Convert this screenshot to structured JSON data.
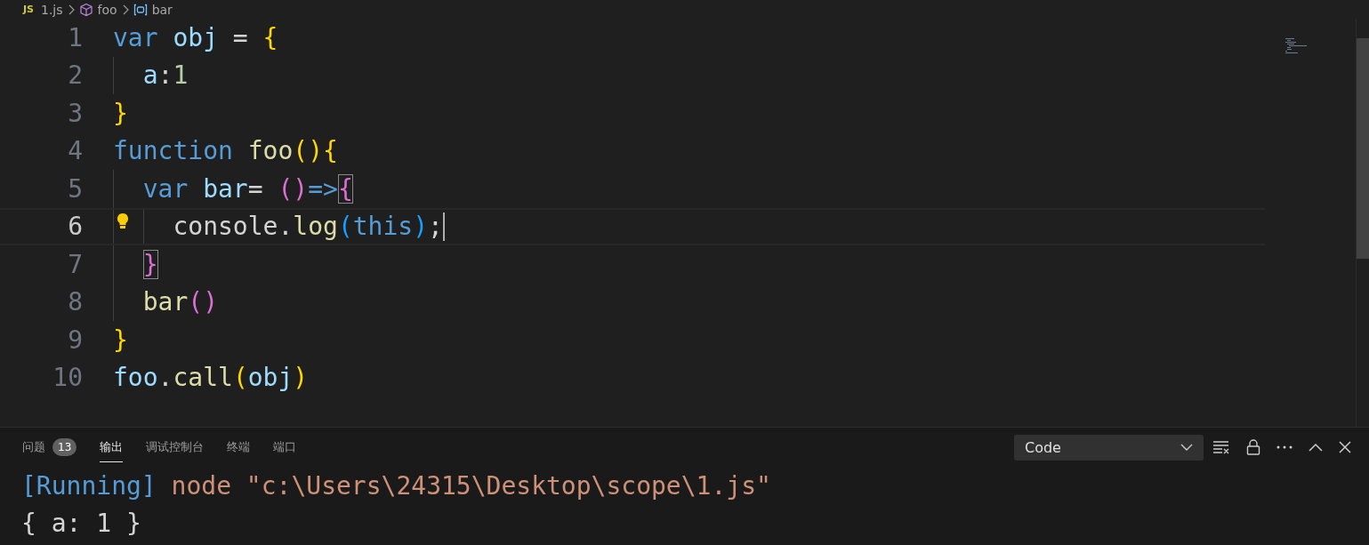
{
  "breadcrumb": [
    {
      "kind": "file",
      "badge": "JS",
      "label": "1.js"
    },
    {
      "kind": "function",
      "label": "foo"
    },
    {
      "kind": "variable",
      "label": "bar"
    }
  ],
  "editor": {
    "lines": [
      {
        "number": "1",
        "current": false,
        "lightbulb": false,
        "tokens": [
          {
            "kind": "keyword",
            "text": "var"
          },
          {
            "kind": "variable",
            "text": " obj"
          },
          {
            "kind": "plain",
            "text": " = "
          },
          {
            "kind": "brace1",
            "text": "{"
          }
        ]
      },
      {
        "number": "2",
        "current": false,
        "lightbulb": false,
        "tokens": [
          {
            "kind": "variable",
            "text": "  a"
          },
          {
            "kind": "plain",
            "text": ":"
          },
          {
            "kind": "number",
            "text": "1"
          }
        ]
      },
      {
        "number": "3",
        "current": false,
        "lightbulb": false,
        "tokens": [
          {
            "kind": "brace1",
            "text": "}"
          }
        ]
      },
      {
        "number": "4",
        "current": false,
        "lightbulb": false,
        "tokens": [
          {
            "kind": "keyword",
            "text": "function"
          },
          {
            "kind": "function",
            "text": " foo"
          },
          {
            "kind": "brace1",
            "text": "(){"
          }
        ]
      },
      {
        "number": "5",
        "current": false,
        "lightbulb": false,
        "tokens": [
          {
            "kind": "keyword",
            "text": "  var"
          },
          {
            "kind": "variable",
            "text": " bar"
          },
          {
            "kind": "plain",
            "text": "= "
          },
          {
            "kind": "brace2",
            "text": "()"
          },
          {
            "kind": "keyword",
            "text": "=>"
          },
          {
            "kind": "brace2",
            "text": "{",
            "matched": true
          }
        ]
      },
      {
        "number": "6",
        "current": true,
        "lightbulb": true,
        "tokens": [
          {
            "kind": "plain",
            "text": "    console."
          },
          {
            "kind": "function",
            "text": "log"
          },
          {
            "kind": "brace3",
            "text": "("
          },
          {
            "kind": "keyword",
            "text": "this"
          },
          {
            "kind": "brace3",
            "text": ")"
          },
          {
            "kind": "plain",
            "text": ";"
          }
        ]
      },
      {
        "number": "7",
        "current": false,
        "lightbulb": false,
        "tokens": [
          {
            "kind": "brace2",
            "text": "  }",
            "matched": true
          }
        ]
      },
      {
        "number": "8",
        "current": false,
        "lightbulb": false,
        "tokens": [
          {
            "kind": "function",
            "text": "  bar"
          },
          {
            "kind": "brace2",
            "text": "()"
          }
        ]
      },
      {
        "number": "9",
        "current": false,
        "lightbulb": false,
        "tokens": [
          {
            "kind": "brace1",
            "text": "}"
          }
        ]
      },
      {
        "number": "10",
        "current": false,
        "lightbulb": false,
        "tokens": [
          {
            "kind": "variable",
            "text": "foo"
          },
          {
            "kind": "plain",
            "text": "."
          },
          {
            "kind": "function",
            "text": "call"
          },
          {
            "kind": "brace1",
            "text": "("
          },
          {
            "kind": "variable",
            "text": "obj"
          },
          {
            "kind": "brace1",
            "text": ")"
          }
        ]
      }
    ]
  },
  "panel": {
    "tabs": [
      {
        "label": "问题",
        "badge": "13",
        "selected": false
      },
      {
        "label": "输出",
        "selected": true
      },
      {
        "label": "调试控制台",
        "selected": false
      },
      {
        "label": "终端",
        "selected": false
      },
      {
        "label": "端口",
        "selected": false
      }
    ],
    "channel_select": {
      "value": "Code"
    },
    "output": [
      [
        {
          "kind": "info",
          "text": "[Running]"
        },
        {
          "kind": "string",
          "text": " node \"c:\\Users\\24315\\Desktop\\scope\\1.js\""
        }
      ],
      [
        {
          "kind": "plain",
          "text": "{ a: 1 }"
        }
      ]
    ]
  }
}
